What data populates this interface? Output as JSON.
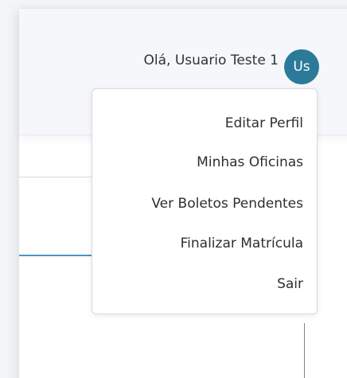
{
  "header": {
    "greeting": "Olá, Usuario Teste 1",
    "avatar_initials": "Us",
    "avatar_color": "#2b7a99"
  },
  "menu": {
    "items": [
      {
        "label": "Editar Perfil"
      },
      {
        "label": "Minhas Oficinas"
      },
      {
        "label": "Ver Boletos Pendentes"
      },
      {
        "label": "Finalizar Matrícula"
      },
      {
        "label": "Sair"
      }
    ]
  }
}
